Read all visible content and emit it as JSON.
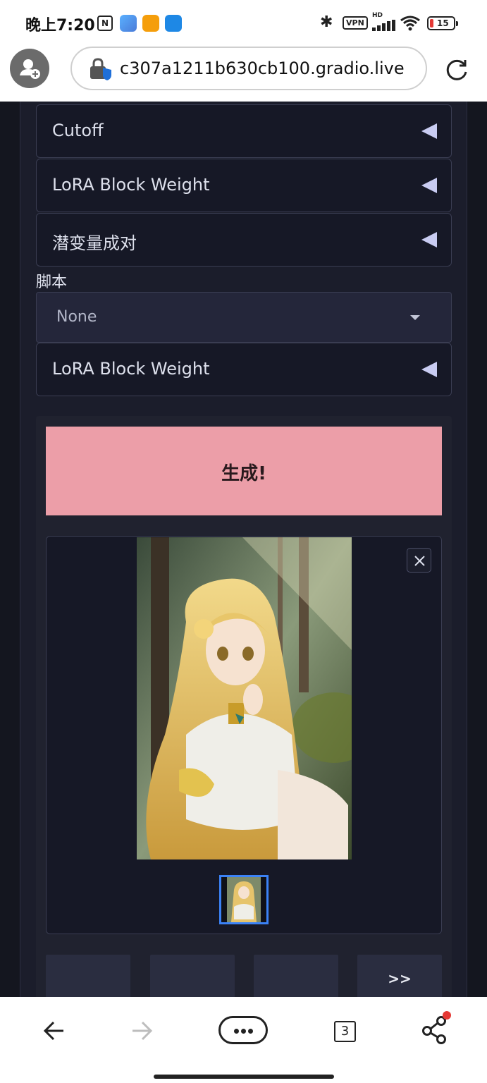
{
  "status_bar": {
    "time": "晚上7:20",
    "nfc_label": "N",
    "vpn_label": "VPN",
    "network_label": "HD",
    "battery_level": "15",
    "icons": [
      "nfc-icon",
      "app-icon",
      "app-icon",
      "app-icon",
      "bluetooth-icon",
      "vpn-icon",
      "signal-icon",
      "wifi-icon",
      "battery-icon"
    ],
    "app_icon_colors": [
      "#4a90e2",
      "#f59e0b",
      "#1e88e5"
    ]
  },
  "browser": {
    "url": "c307a1211b630cb100.gradio.live",
    "icons": [
      "profile-icon",
      "lock-icon",
      "reload-icon"
    ]
  },
  "accordions": [
    {
      "label": "Cutoff"
    },
    {
      "label": "LoRA Block Weight"
    },
    {
      "label": "潜变量成对"
    }
  ],
  "script": {
    "label": "脚本",
    "selected": "None"
  },
  "accordion_after": {
    "label": "LoRA Block Weight"
  },
  "generate": {
    "label": "生成!",
    "color": "#ec9ea8"
  },
  "gallery": {
    "close_icon": "close-icon",
    "thumbnail_border": "#3b82f6"
  },
  "action_buttons": [
    {
      "label": ""
    },
    {
      "label": ""
    },
    {
      "label": ""
    },
    {
      "label": ">>"
    }
  ],
  "nav": {
    "tab_count": "3",
    "icons": [
      "back-icon",
      "forward-icon",
      "more-icon",
      "tabs-icon",
      "share-icon"
    ]
  }
}
